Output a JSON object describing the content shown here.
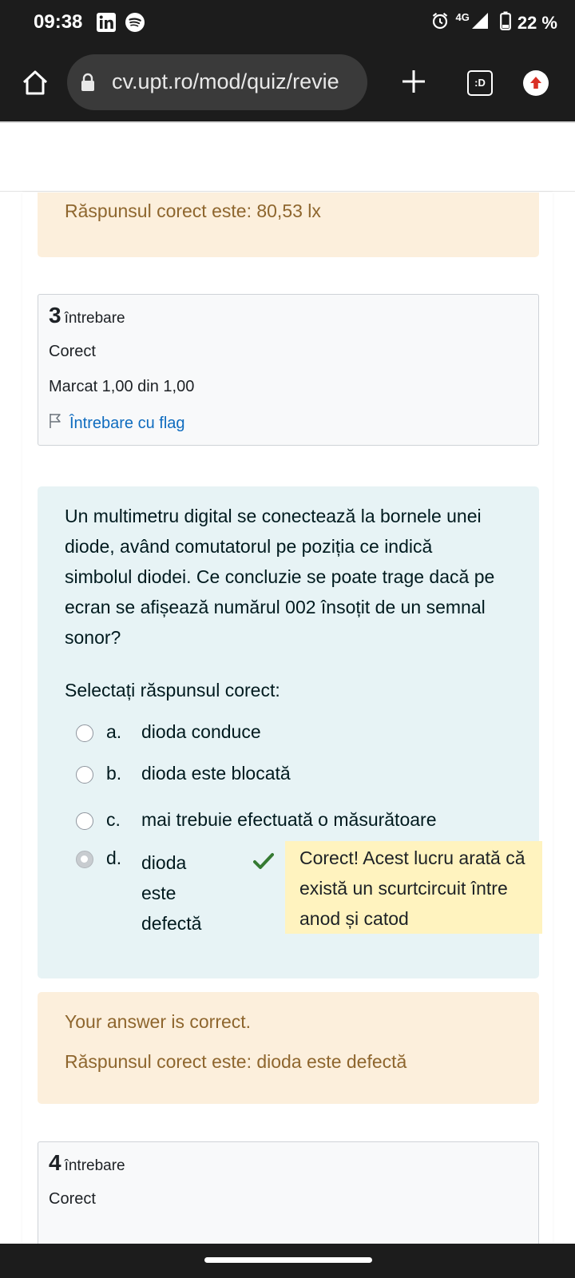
{
  "status_bar": {
    "time": "09:38",
    "network": "4G",
    "battery": "22 %"
  },
  "browser": {
    "url": "cv.upt.ro/mod/quiz/revie",
    "tabs_label": ":D"
  },
  "prev_feedback": {
    "correct_answer": "Răspunsul corect este: 80,53 lx"
  },
  "question3": {
    "number": "3",
    "number_word": "întrebare",
    "status": "Corect",
    "mark": "Marcat 1,00 din 1,00",
    "flag_label": "Întrebare cu flag",
    "text": "Un multimetru digital se conectează la bornele unei diode, având comutatorul pe poziția ce indică simbolul diodei. Ce concluzie se poate trage dacă pe ecran se afișează numărul 002 însoțit de un semnal sonor?",
    "prompt": "Selectați răspunsul corect:",
    "options": [
      {
        "letter": "a.",
        "text": "dioda conduce"
      },
      {
        "letter": "b.",
        "text": "dioda este blocată"
      },
      {
        "letter": "c.",
        "text": "mai trebuie efectuată o măsurătoare"
      },
      {
        "letter": "d.",
        "text": "dioda este defectă",
        "selected": true
      }
    ],
    "selected_feedback": "Corect! Acest lucru arată că există un scurtcircuit între anod și catod",
    "feedback_general": "Your answer is correct.",
    "feedback_correct": "Răspunsul corect este: dioda este defectă"
  },
  "question4": {
    "number": "4",
    "number_word": "întrebare",
    "status": "Corect"
  },
  "colors": {
    "feedback_bg": "#fcefdc",
    "feedback_text": "#8e662e",
    "question_bg": "#e7f3f5",
    "link": "#0f6cbf",
    "correct_green": "#357a32",
    "highlight": "#fff3bf"
  }
}
